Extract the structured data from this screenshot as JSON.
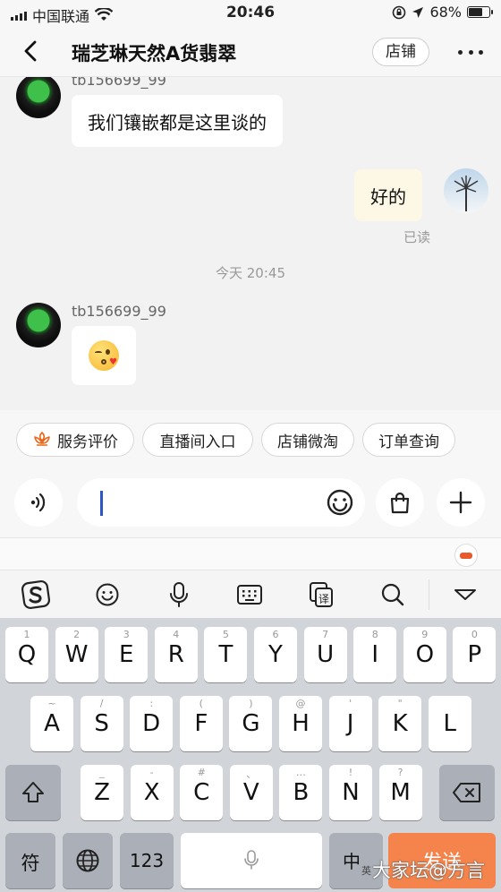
{
  "status": {
    "carrier": "中国联通",
    "time": "20:46",
    "battery": "68%",
    "battery_level": 0.68
  },
  "header": {
    "back_icon": "chevron-left-icon",
    "title": "瑞芝琳天然A货翡翠",
    "shop_button": "店铺",
    "more_icon": "more-dots-icon"
  },
  "messages": [
    {
      "sender": "tb156699_99",
      "text": "我们镶嵌都是这里谈的",
      "side": "left"
    },
    {
      "text": "好的",
      "side": "right",
      "status": "已读"
    },
    {
      "timestamp": "今天 20:45"
    },
    {
      "sender": "tb156699_99",
      "emoji": "kissing-heart-emoji",
      "side": "left"
    }
  ],
  "quick_actions": [
    {
      "label": "服务评价",
      "icon": "flower-icon"
    },
    {
      "label": "直播间入口"
    },
    {
      "label": "店铺微淘"
    },
    {
      "label": "订单查询"
    }
  ],
  "input": {
    "value": "",
    "voice_icon": "voice-icon",
    "emoji_icon": "smile-icon",
    "bag_icon": "shopping-bag-icon",
    "plus_icon": "plus-icon"
  },
  "ime_toolbar": [
    "sogou-logo-icon",
    "emoji-icon",
    "microphone-icon",
    "keyboard-icon",
    "translate-icon",
    "search-icon",
    "collapse-icon"
  ],
  "keyboard": {
    "row1": [
      {
        "m": "Q",
        "s": "1"
      },
      {
        "m": "W",
        "s": "2"
      },
      {
        "m": "E",
        "s": "3"
      },
      {
        "m": "R",
        "s": "4"
      },
      {
        "m": "T",
        "s": "5"
      },
      {
        "m": "Y",
        "s": "6"
      },
      {
        "m": "U",
        "s": "7"
      },
      {
        "m": "I",
        "s": "8"
      },
      {
        "m": "O",
        "s": "9"
      },
      {
        "m": "P",
        "s": "0"
      }
    ],
    "row2": [
      {
        "m": "A",
        "s": "~"
      },
      {
        "m": "S",
        "s": "/"
      },
      {
        "m": "D",
        "s": ":"
      },
      {
        "m": "F",
        "s": "("
      },
      {
        "m": "G",
        "s": ")"
      },
      {
        "m": "H",
        "s": "@"
      },
      {
        "m": "J",
        "s": "'"
      },
      {
        "m": "K",
        "s": "\""
      },
      {
        "m": "L",
        "s": ""
      }
    ],
    "row3": [
      {
        "m": "Z",
        "s": "_"
      },
      {
        "m": "X",
        "s": "-"
      },
      {
        "m": "C",
        "s": "#"
      },
      {
        "m": "V",
        "s": "、"
      },
      {
        "m": "B",
        "s": "…"
      },
      {
        "m": "N",
        "s": "!"
      },
      {
        "m": "M",
        "s": "?"
      }
    ],
    "symbol_key": "符",
    "numbers_key": "123",
    "lang_key": "中",
    "lang_sub": "英",
    "send_key": "发送"
  },
  "watermark": "大家坛@方言"
}
